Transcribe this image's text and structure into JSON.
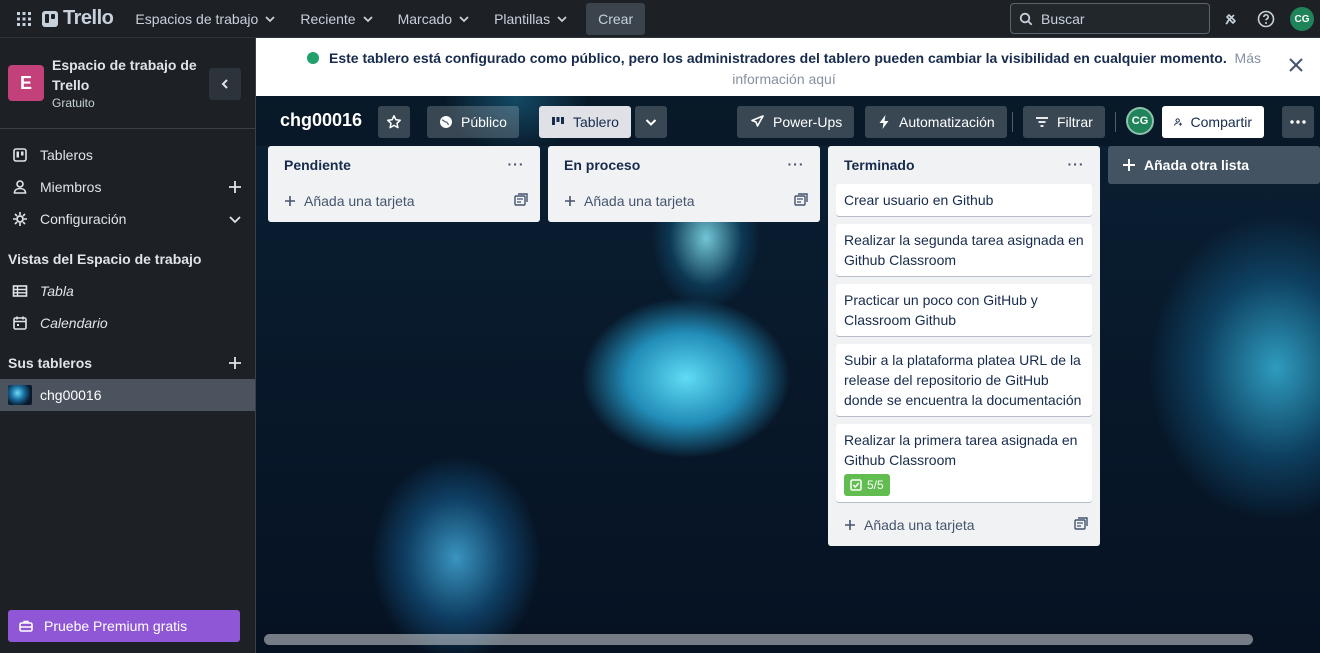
{
  "topbar": {
    "logo": "Trello",
    "menus": [
      "Espacios de trabajo",
      "Reciente",
      "Marcado",
      "Plantillas"
    ],
    "create": "Crear",
    "search_placeholder": "Buscar",
    "user_initials": "CG"
  },
  "sidebar": {
    "workspace_initial": "E",
    "workspace_name": "Espacio de trabajo de Trello",
    "workspace_plan": "Gratuito",
    "items": [
      {
        "label": "Tableros"
      },
      {
        "label": "Miembros"
      },
      {
        "label": "Configuración"
      }
    ],
    "views_title": "Vistas del Espacio de trabajo",
    "views": [
      {
        "label": "Tabla"
      },
      {
        "label": "Calendario"
      }
    ],
    "boards_title": "Sus tableros",
    "boards": [
      {
        "label": "chg00016"
      }
    ],
    "premium": "Pruebe Premium gratis"
  },
  "banner": {
    "message": "Este tablero está configurado como público, pero los administradores del tablero pueden cambiar la visibilidad en cualquier momento.",
    "link": "Más información aquí"
  },
  "board": {
    "title": "chg00016",
    "visibility": "Público",
    "view": "Tablero",
    "powerups": "Power-Ups",
    "automation": "Automatización",
    "filter": "Filtrar",
    "member_initials": "CG",
    "share": "Compartir",
    "add_list": "Añada otra lista",
    "add_card": "Añada una tarjeta"
  },
  "lists": [
    {
      "title": "Pendiente",
      "cards": []
    },
    {
      "title": "En proceso",
      "cards": []
    },
    {
      "title": "Terminado",
      "cards": [
        {
          "text": "Crear usuario en Github"
        },
        {
          "text": "Realizar la segunda tarea asignada en Github Classroom"
        },
        {
          "text": "Practicar un poco con GitHub y Classroom Github"
        },
        {
          "text": "Subir a la plataforma platea URL de la release del repositorio de GitHub donde se encuentra la documentación"
        },
        {
          "text": "Realizar la primera tarea asignada en Github Classroom",
          "checklist": "5/5"
        }
      ]
    }
  ],
  "colors": {
    "topbar": "#1d2125",
    "workspace_avatar": "#c2417a",
    "premium": "#8f57d6",
    "checklist_badge": "#61bd4f",
    "member_avatar": "#1f845a"
  }
}
